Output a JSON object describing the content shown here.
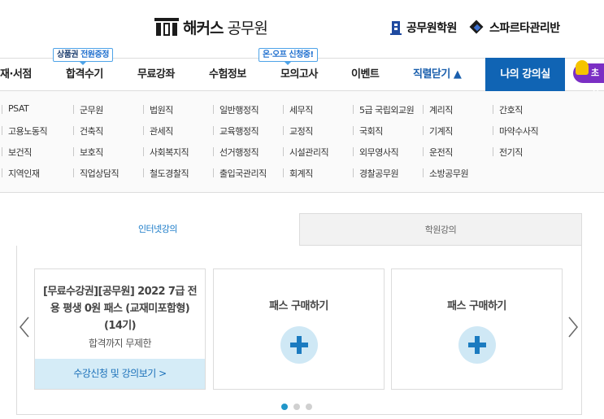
{
  "header": {
    "logo_brand": "해커스",
    "logo_sub": "공무원",
    "links": [
      {
        "label": "공무원학원",
        "icon": "building-icon"
      },
      {
        "label": "스파르타관리반",
        "icon": "sparta-helmet-icon"
      }
    ]
  },
  "badges": {
    "gift_prefix": "상품권",
    "gift_text": "전원증정",
    "online": "온·오프 신청중!"
  },
  "gnb": {
    "items": [
      "재·서점",
      "합격수기",
      "무료강좌",
      "수험정보",
      "모의고사",
      "이벤트",
      "직렬닫기 ▲"
    ],
    "my_class": "나의 강의실",
    "extra": "초시"
  },
  "categories": [
    [
      "PSAT",
      "군무원",
      "법원직",
      "일반행정직",
      "세무직",
      "5급 국립외교원",
      "계리직",
      "간호직"
    ],
    [
      "고용노동직",
      "건축직",
      "관세직",
      "교육행정직",
      "교정직",
      "국회직",
      "기계직",
      "마약수사직"
    ],
    [
      "보건직",
      "보호직",
      "사회복지직",
      "선거행정직",
      "시설관리직",
      "외무영사직",
      "운전직",
      "전기직"
    ],
    [
      "지역인재",
      "직업상담직",
      "철도경찰직",
      "출입국관리직",
      "회계직",
      "경찰공무원",
      "소방공무원"
    ]
  ],
  "tabs": {
    "online": "인터넷강의",
    "academy": "학원강의"
  },
  "cards": {
    "first_title": "[무료수강권][공무원] 2022 7급 전용 평생 0원 패스 (교재미포함형) (14기)",
    "first_sub": "합격까지 무제한",
    "first_button": "수강신청 및 강의보기 >",
    "pass_title": "패스 구매하기"
  },
  "colors": {
    "accent_blue": "#1064b4",
    "tab_active": "#1a7bc8",
    "dot_active": "#2196c9"
  }
}
